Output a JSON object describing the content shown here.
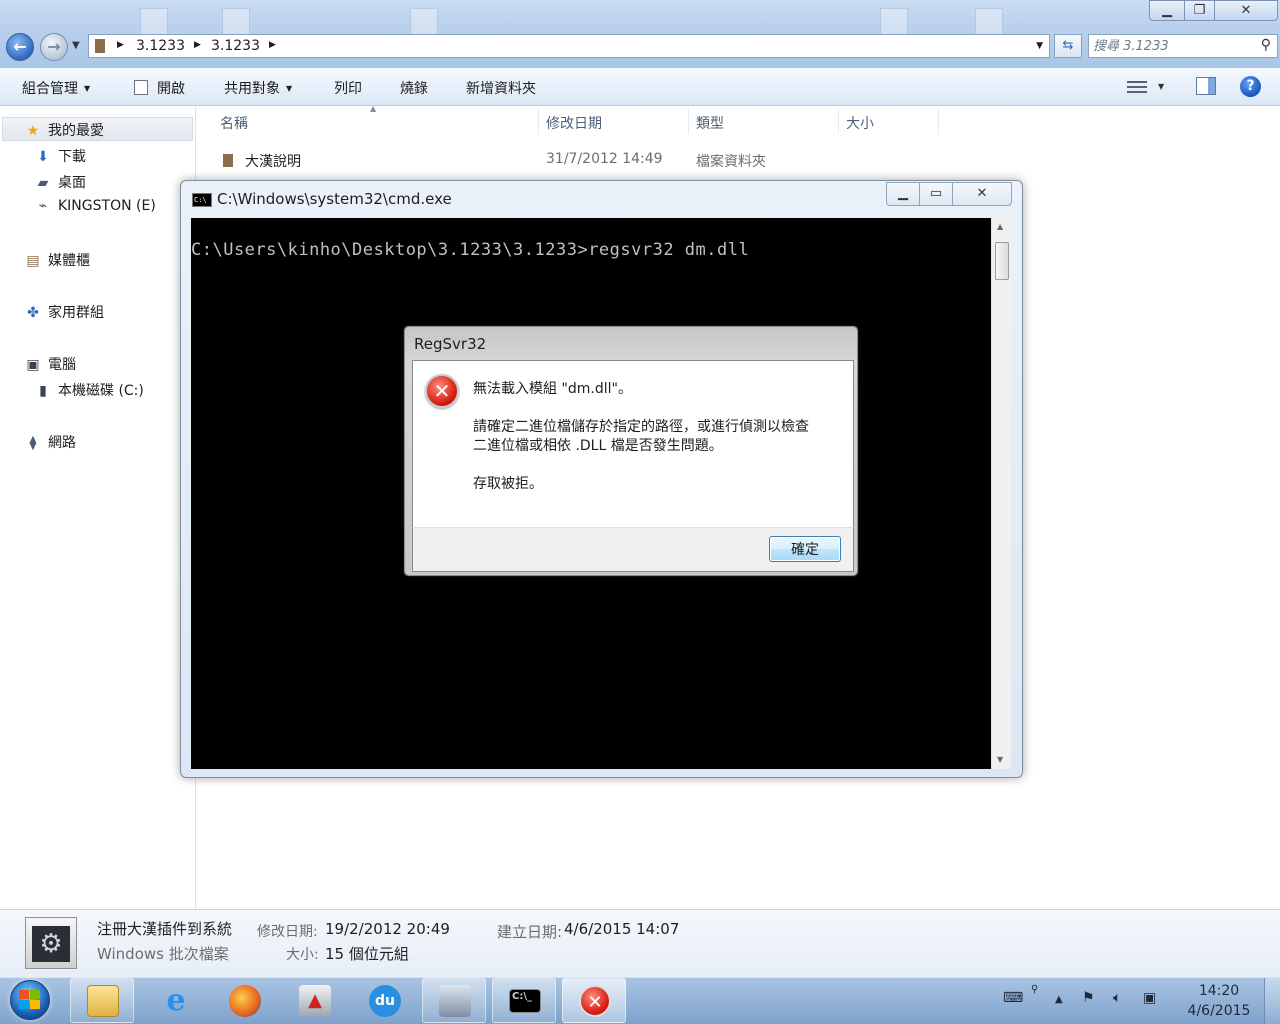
{
  "explorer": {
    "breadcrumb": [
      "3.1233",
      "3.1233"
    ],
    "search_placeholder": "搜尋 3.1233",
    "toolbar": {
      "organize": "組合管理",
      "open": "開啟",
      "share": "共用對象",
      "print": "列印",
      "burn": "燒錄",
      "new_folder": "新增資料夾"
    },
    "nav": {
      "favorites": "我的最愛",
      "downloads": "下載",
      "desktop": "桌面",
      "kingston": "KINGSTON (E)",
      "libraries": "媒體櫃",
      "homegroup": "家用群組",
      "computer": "電腦",
      "local_disk": "本機磁碟 (C:)",
      "network": "網路"
    },
    "columns": [
      "名稱",
      "修改日期",
      "類型",
      "大小"
    ],
    "rows": [
      {
        "name": "大漢說明",
        "modified": "31/7/2012 14:49",
        "type": "檔案資料夾",
        "size": ""
      }
    ],
    "details": {
      "filename": "注冊大漢插件到系統",
      "filetype": "Windows 批次檔案",
      "modified_label": "修改日期:",
      "modified_value": "19/2/2012 20:49",
      "created_label": "建立日期:",
      "created_value": "4/6/2015 14:07",
      "size_label": "大小:",
      "size_value": "15 個位元組"
    }
  },
  "cmd": {
    "title": "C:\\Windows\\system32\\cmd.exe",
    "icon_text": "C:\\",
    "line": "C:\\Users\\kinho\\Desktop\\3.1233\\3.1233>regsvr32 dm.dll"
  },
  "dialog": {
    "title": "RegSvr32",
    "line1": "無法載入模組 \"dm.dll\"。",
    "line2": "請確定二進位檔儲存於指定的路徑，或進行偵測以檢查",
    "line3": "二進位檔或相依 .DLL 檔是否發生問題。",
    "line4": "存取被拒。",
    "ok": "確定"
  },
  "taskbar": {
    "time": "14:20",
    "date": "4/6/2015",
    "apps": [
      "explorer-icon",
      "ie-icon",
      "firefox-icon",
      "gundam-icon",
      "du-icon",
      "app-icon",
      "cmd-icon",
      "error-icon"
    ],
    "du_label": "du"
  },
  "colors": {
    "accent": "#2f68c2",
    "error": "#d51c12",
    "console_bg": "#000000",
    "console_fg": "#c0c0c0"
  }
}
